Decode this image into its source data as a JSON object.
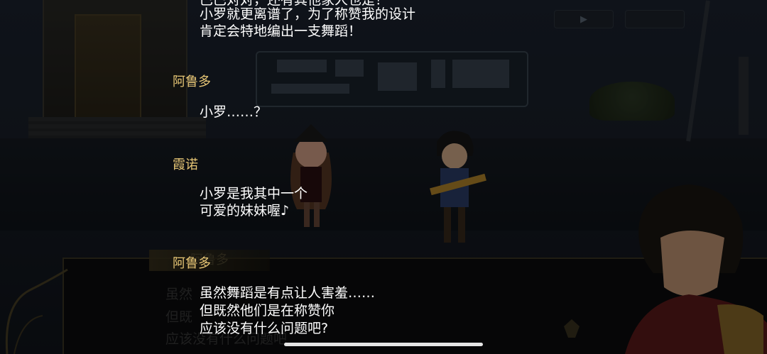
{
  "log": {
    "entry0": {
      "line0": "巴巴对对，还有其他家人也是！",
      "line1": "小罗就更离谱了，为了称赞我的设计",
      "line2": "肯定会特地编出一支舞蹈！"
    },
    "entry1": {
      "speaker": "阿鲁多",
      "line0": "小罗……？"
    },
    "entry2": {
      "speaker": "霞诺",
      "line0": "小罗是我其中一个",
      "line1": "可爱的妹妹喔♪"
    },
    "entry3": {
      "speaker": "阿鲁多",
      "line0": "虽然舞蹈是有点让人害羞……",
      "line1": "但既然他们是在称赞你",
      "line2": "应该没有什么问题吧?"
    }
  },
  "background_dialog": {
    "name": "阿鲁多",
    "line0": "虽然",
    "line1": "但既",
    "line2": "应该没有什么问题吧"
  },
  "icons": {
    "auto": "play-triangle-icon",
    "crest": "crest-emblem-icon",
    "ornament": "frame-ornament-icon"
  },
  "colors": {
    "speaker_name": "#e8c776",
    "dialog_text": "#ffffff",
    "textbox_border": "#3b3523"
  }
}
